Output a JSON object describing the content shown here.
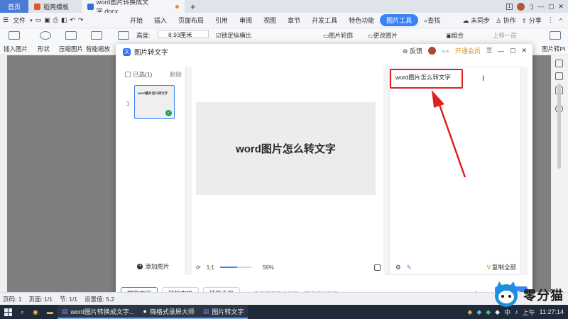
{
  "tabbar": {
    "home_label": "首页",
    "template_label": "稻壳模板",
    "doc_label": "word图片转换成文字.docx",
    "new_tab": "+",
    "window_num": "1",
    "user_text": ":)"
  },
  "menubar": {
    "file_label": "文件",
    "items": [
      "开始",
      "插入",
      "页面布局",
      "引用",
      "审阅",
      "视图",
      "章节",
      "开发工具",
      "特色功能",
      "图片工具"
    ],
    "active_label": "图片工具",
    "search_label": "查找",
    "sync_label": "未同步",
    "collab_label": "协作",
    "share_label": "分享"
  },
  "ribbon": {
    "insert_pic": "插入图片",
    "shape": "形状",
    "compress": "压缩图片",
    "smart": "智能缩放",
    "height_label": "高度:",
    "height_value": "8.93厘米",
    "lock_ratio": "锁定纵横比",
    "outline": "图片轮廓",
    "change_pic": "更改图片",
    "group": "组合",
    "up_layer": "上移一层",
    "pic_to_text": "图片转PI"
  },
  "dialog": {
    "title": "图片转文字",
    "feedback": "反馈",
    "vip": "开通会员",
    "selected_label": "已选(1)",
    "delete_label": "删除",
    "thumb_index": "1",
    "thumb_text": "word图片怎么转文字",
    "add_picture": "添加图片",
    "preview_text": "word图片怎么转文字",
    "ratio_label": "1:1",
    "zoom_value": "56%",
    "zoom_fraction": 0.56,
    "result_text": "word图片怎么转文字",
    "copy_all": "复制全部",
    "copy_badge": "V",
    "extract_btn": "提取文字",
    "convert_doc_btn": "转换文档",
    "convert_table_btn": "转换表格",
    "hint": "快速提取文本内容，转换识别率高",
    "format": "docx",
    "start_btn": "开始转"
  },
  "statusbar": {
    "page": "页码: 1",
    "pages": "页面: 1/1",
    "section": "节: 1/1",
    "setting": "设置值: 5.2"
  },
  "taskbar": {
    "word_window": "word图片转换成文字...",
    "recorder": "嗨格式录屏大师",
    "pic_to_text": "图片转文字",
    "ime": "中",
    "period": "上午",
    "time": "11:27:14"
  },
  "watermark": {
    "text": "零分猫"
  },
  "colors": {
    "accent": "#3b82f6",
    "highlight": "#e02020",
    "vip": "#d4932a",
    "check": "#22a356"
  }
}
